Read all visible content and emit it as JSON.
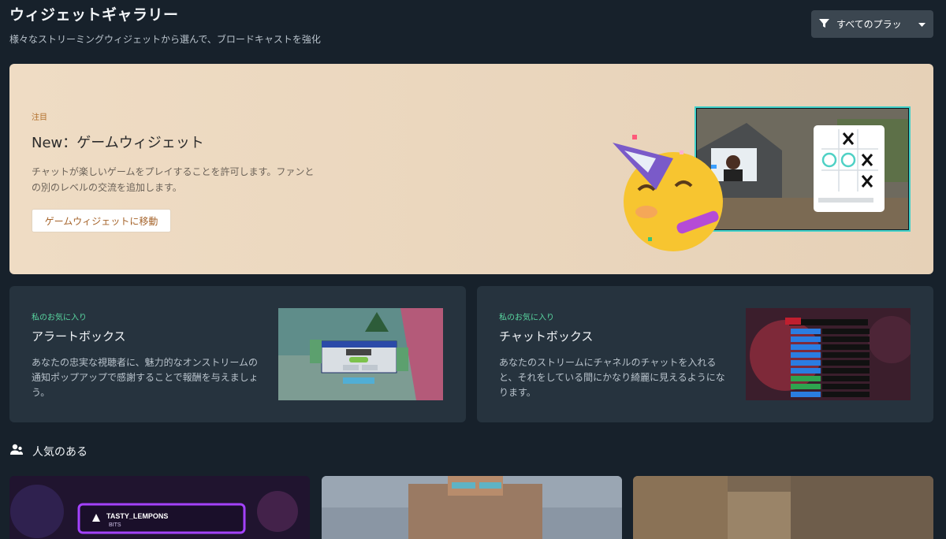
{
  "header": {
    "title": "ウィジェットギャラリー",
    "subtitle": "様々なストリーミングウィジェットから選んで、ブロードキャストを強化",
    "platform_filter": "すべてのプラッ"
  },
  "featured": {
    "eyebrow": "注目",
    "title": "New：ゲームウィジェット",
    "description": "チャットが楽しいゲームをプレイすることを許可します。ファンとの別のレベルの交流を追加します。",
    "cta": "ゲームウィジェットに移動"
  },
  "favorites": [
    {
      "tag": "私のお気に入り",
      "name": "アラートボックス",
      "description": "あなたの忠実な視聴者に、魅力的なオンストリームの通知ポップアップで感謝することで報酬を与えましょう。"
    },
    {
      "tag": "私のお気に入り",
      "name": "チャットボックス",
      "description": "あなたのストリームにチャネルのチャットを入れると、それをしている間にかなり綺麗に見えるようになります。"
    }
  ],
  "popular": {
    "heading": "人気のある",
    "cards": [
      {
        "name": "TASTY_LEMPONS",
        "sub": "BITS"
      },
      {
        "name": ""
      },
      {
        "name": ""
      }
    ]
  },
  "colors": {
    "background": "#17212b",
    "card": "#26333e",
    "featured_bg": "#ead6bd",
    "accent_green": "#59d6a0",
    "accent_orange": "#b26f2b"
  }
}
